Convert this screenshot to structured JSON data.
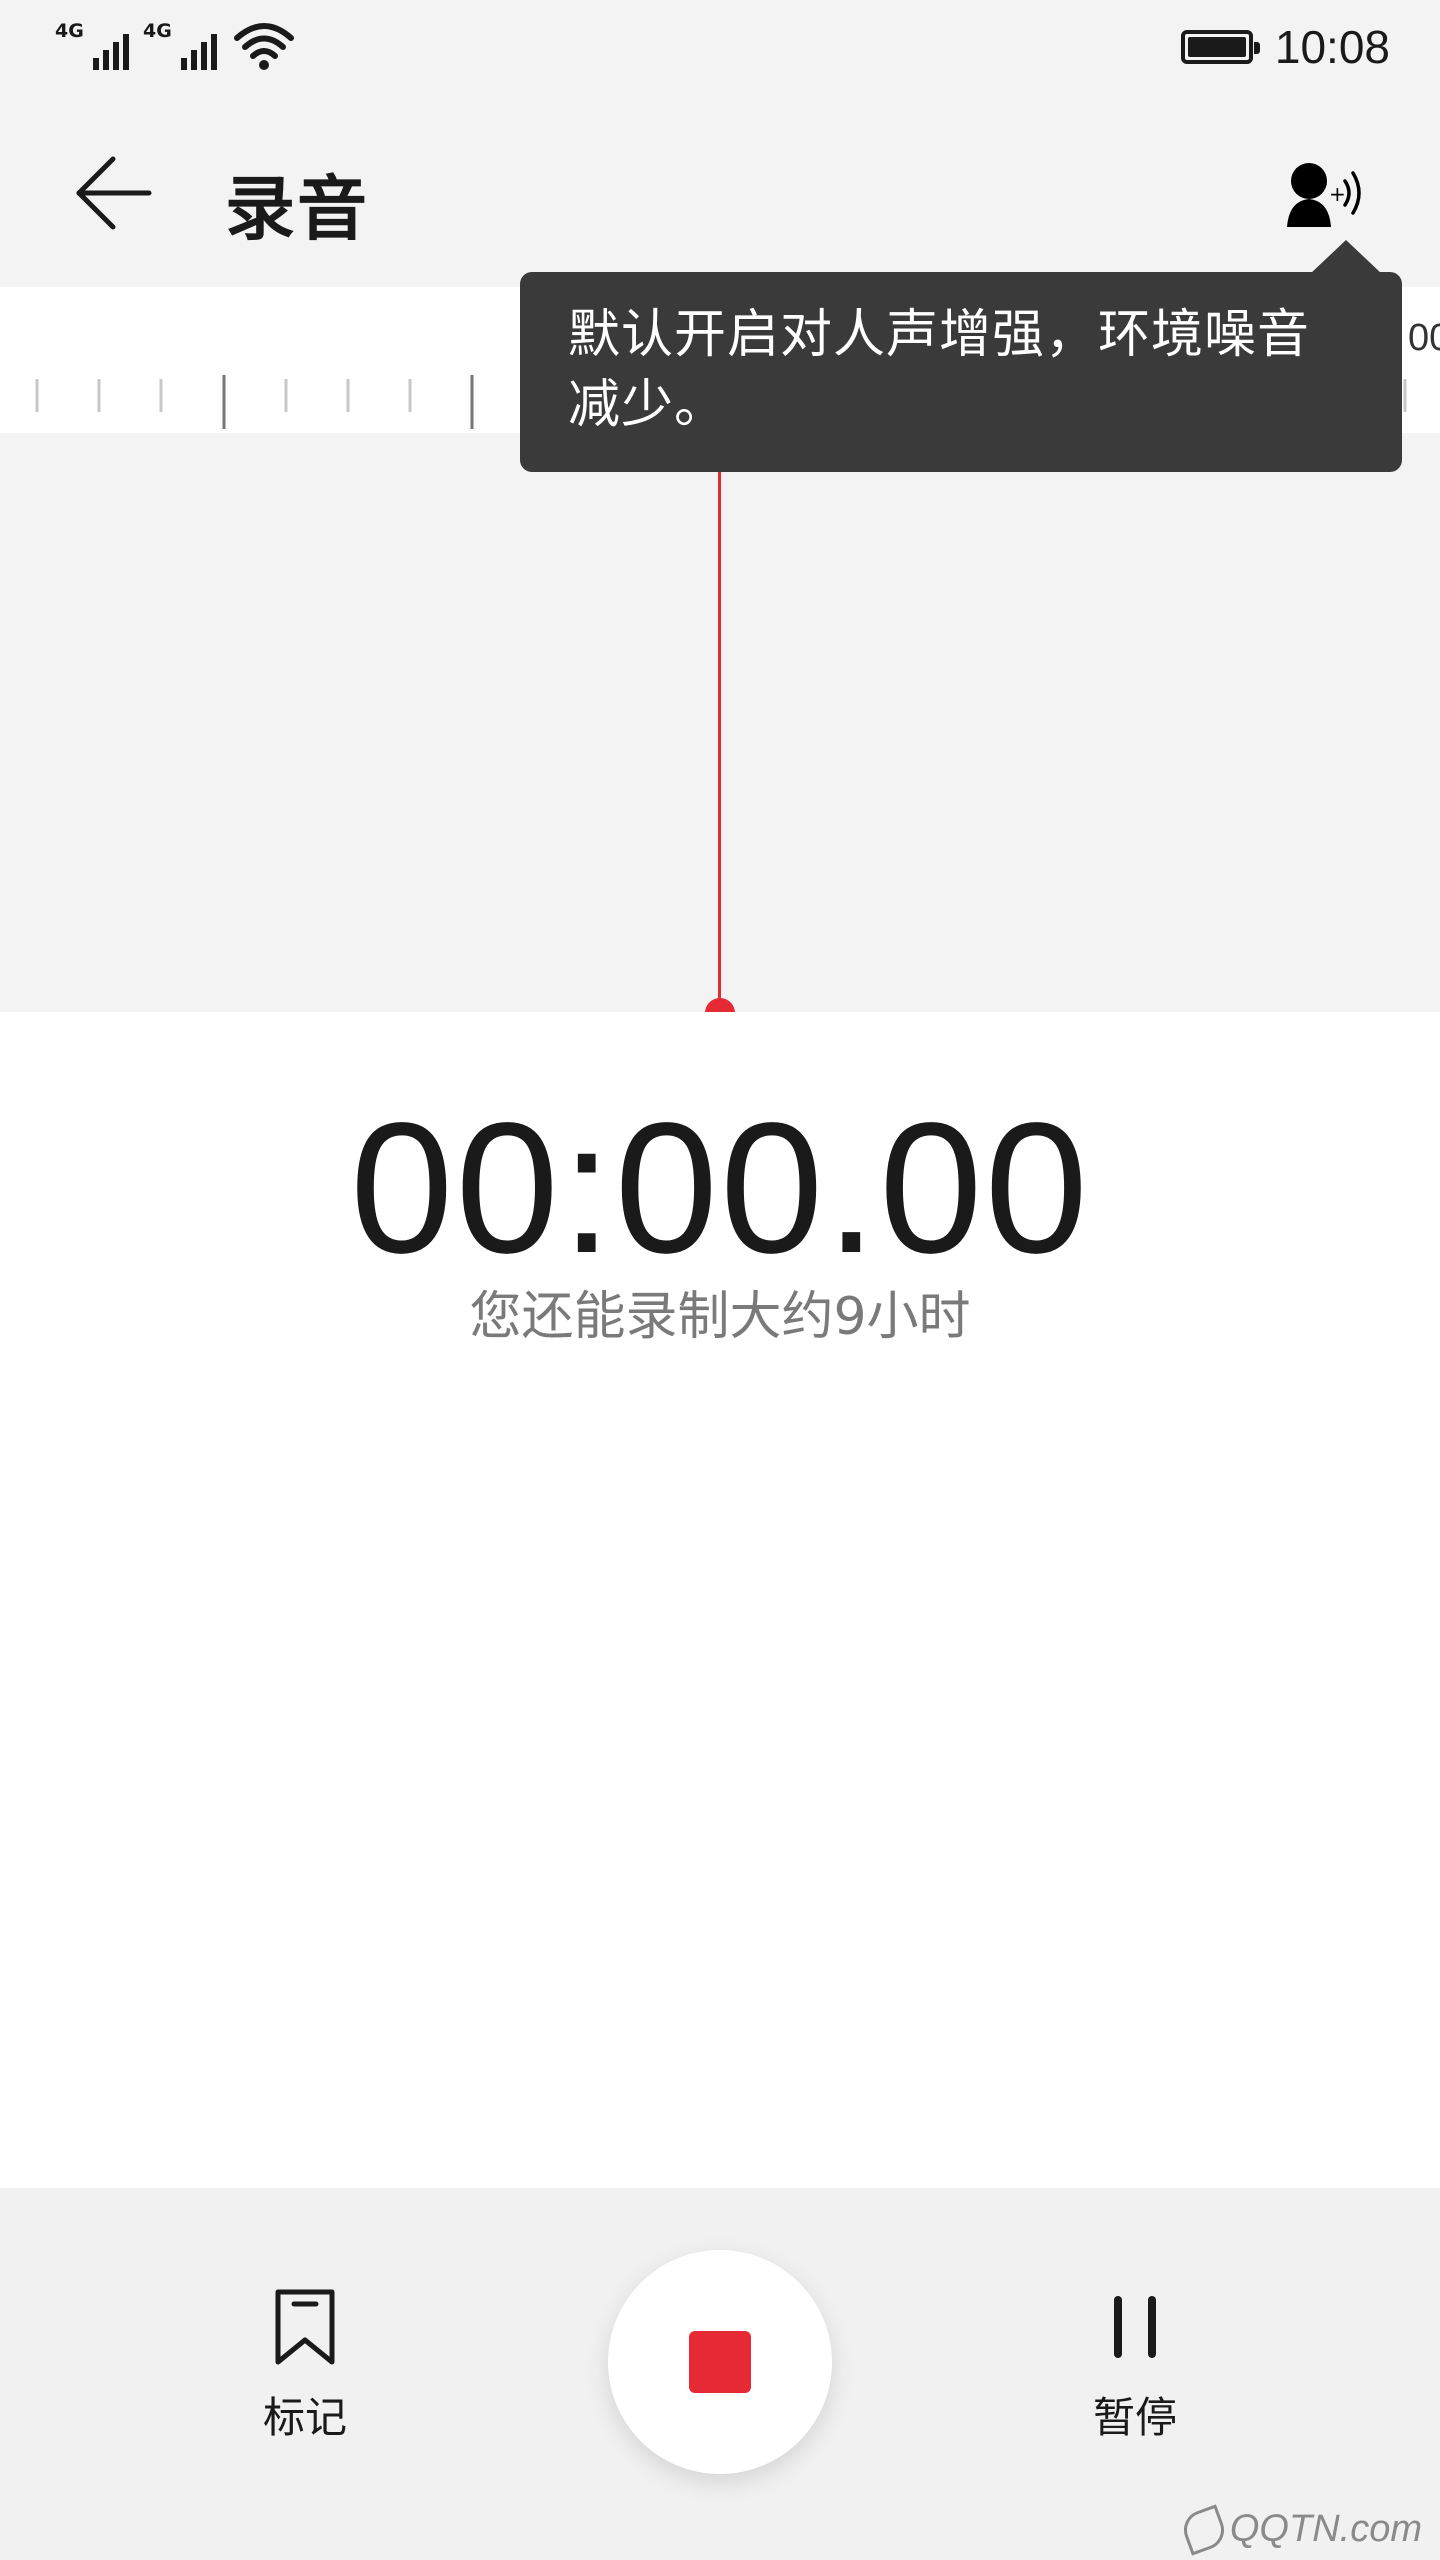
{
  "status_bar": {
    "sim1_type": "4G",
    "sim2_type": "4G",
    "battery_level": 1.0,
    "time": "10:08"
  },
  "header": {
    "title": "录音",
    "back_icon": "arrow-left-icon",
    "voice_enhance_icon": "voice-enhance-icon"
  },
  "ruler": {
    "edge_label": "00"
  },
  "tooltip": {
    "text": "默认开启对人声增强，环境噪音减少。"
  },
  "recorder": {
    "elapsed": "00:00.00",
    "remaining_text": "您还能录制大约9小时"
  },
  "controls": {
    "mark_label": "标记",
    "mark_icon": "bookmark-icon",
    "stop_icon": "stop-icon",
    "pause_label": "暂停",
    "pause_icon": "pause-icon"
  },
  "colors": {
    "accent": "#e52a36",
    "tooltip_bg": "#3a3a3a",
    "background": "#f3f3f3"
  },
  "watermark": {
    "text": "QQTN.com"
  }
}
